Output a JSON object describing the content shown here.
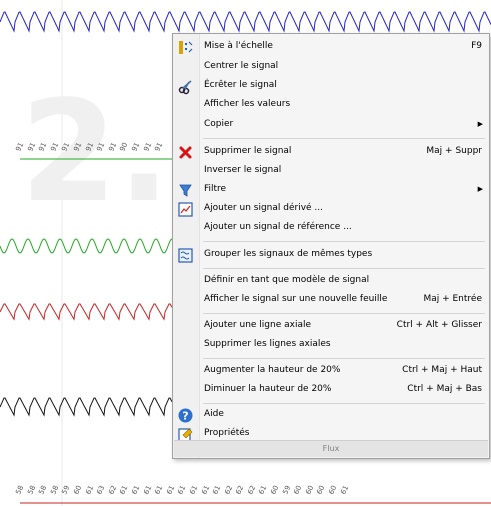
{
  "background": {
    "tick_row_top": [
      "91",
      "91",
      "91",
      "91",
      "91",
      "91",
      "91",
      "91",
      "91",
      "90",
      "91",
      "91",
      "91"
    ],
    "tick_row_bottom": [
      "58",
      "58",
      "58",
      "58",
      "59",
      "60",
      "61",
      "63",
      "62",
      "61",
      "61",
      "61",
      "61",
      "61",
      "61",
      "61",
      "61",
      "61",
      "62",
      "62",
      "62",
      "61",
      "60",
      "59",
      "60",
      "60",
      "60",
      "60",
      "61"
    ]
  },
  "context_menu": {
    "items": [
      {
        "label": "Mise à l'échelle",
        "shortcut": "F9",
        "icon": "scale-icon"
      },
      {
        "label": "Centrer le signal"
      },
      {
        "label": "Écrêter le signal",
        "icon": "scissors-icon"
      },
      {
        "label": "Afficher les valeurs"
      },
      {
        "label": "Copier",
        "submenu": true
      },
      {
        "label": "Supprimer le signal",
        "shortcut": "Maj + Suppr",
        "icon": "delete-icon"
      },
      {
        "label": "Inverser le signal"
      },
      {
        "label": "Filtre",
        "submenu": true,
        "icon": "filter-icon"
      },
      {
        "label": "Ajouter un signal dérivé ...",
        "icon": "derived-signal-icon"
      },
      {
        "label": "Ajouter un signal de référence ..."
      },
      {
        "label": "Grouper les signaux de mêmes types",
        "icon": "group-signals-icon"
      },
      {
        "label": "Définir en tant que modèle de signal"
      },
      {
        "label": "Afficher le signal sur une nouvelle feuille",
        "shortcut": "Maj + Entrée"
      },
      {
        "label": "Ajouter une ligne axiale",
        "shortcut": "Ctrl + Alt + Glisser"
      },
      {
        "label": "Supprimer les lignes axiales"
      },
      {
        "label": "Augmenter la hauteur de 20%",
        "shortcut": "Ctrl + Maj + Haut"
      },
      {
        "label": "Diminuer la hauteur de 20%",
        "shortcut": "Ctrl + Maj + Bas"
      },
      {
        "label": "Aide",
        "icon": "help-icon"
      },
      {
        "label": "Propriétés",
        "icon": "properties-icon"
      }
    ],
    "footer": "Flux"
  },
  "colors": {
    "signal_blue": "#2222cc",
    "signal_green": "#22aa22",
    "signal_red": "#cc2222",
    "signal_black": "#111111"
  }
}
